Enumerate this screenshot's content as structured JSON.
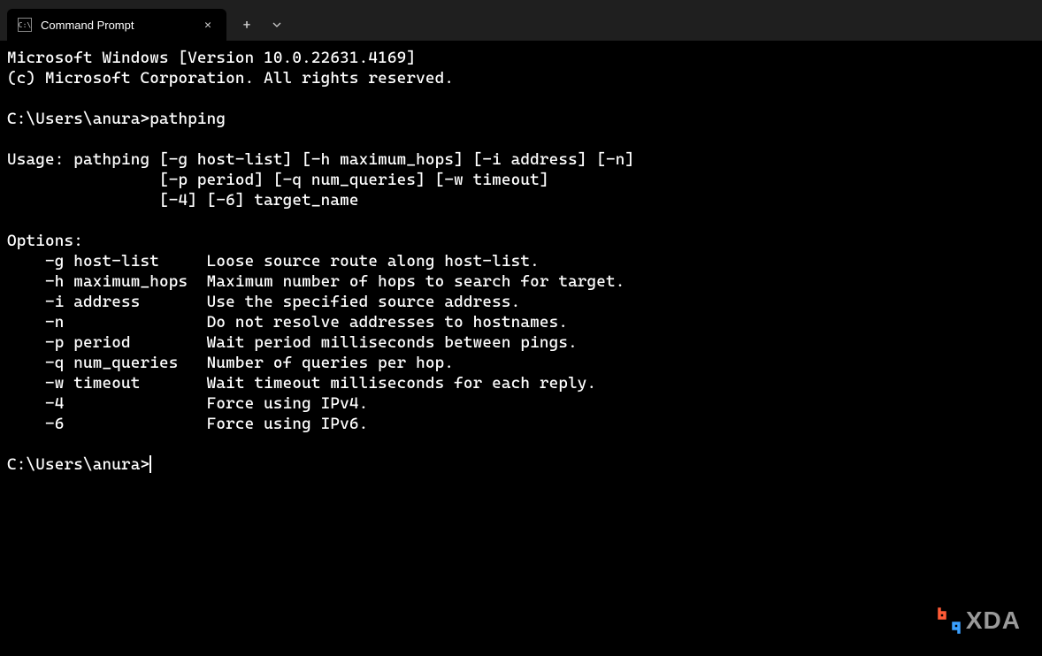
{
  "tab": {
    "title": "Command Prompt",
    "close_glyph": "✕"
  },
  "titlebar": {
    "new_tab_glyph": "+",
    "dropdown_glyph": "⌄"
  },
  "terminal": {
    "lines": [
      "Microsoft Windows [Version 10.0.22631.4169]",
      "(c) Microsoft Corporation. All rights reserved.",
      "",
      "C:\\Users\\anura>pathping",
      "",
      "Usage: pathping [-g host-list] [-h maximum_hops] [-i address] [-n]",
      "                [-p period] [-q num_queries] [-w timeout]",
      "                [-4] [-6] target_name",
      "",
      "Options:",
      "    -g host-list     Loose source route along host-list.",
      "    -h maximum_hops  Maximum number of hops to search for target.",
      "    -i address       Use the specified source address.",
      "    -n               Do not resolve addresses to hostnames.",
      "    -p period        Wait period milliseconds between pings.",
      "    -q num_queries   Number of queries per hop.",
      "    -w timeout       Wait timeout milliseconds for each reply.",
      "    -4               Force using IPv4.",
      "    -6               Force using IPv6.",
      ""
    ],
    "prompt": "C:\\Users\\anura>"
  },
  "watermark": {
    "text": "XDA"
  }
}
